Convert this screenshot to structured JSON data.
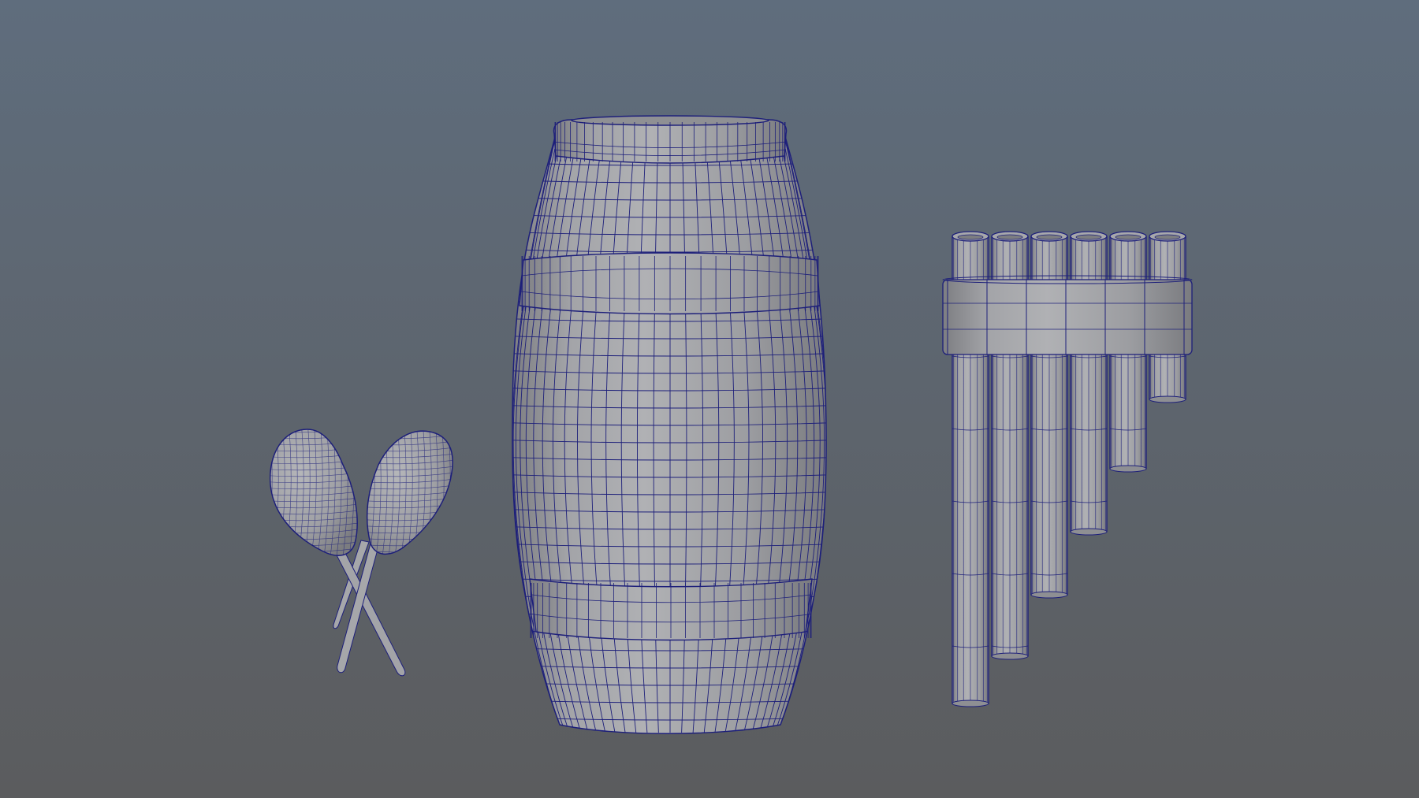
{
  "viewport": {
    "background_top": "#5f6d7d",
    "background_bottom": "#5b5c5e",
    "mesh_surface_light": "#a9aaad",
    "mesh_surface_mid": "#9c9da1",
    "mesh_surface_dark": "#7f8084",
    "wireframe_color": "#1d1f7a"
  },
  "scene": {
    "objects": [
      {
        "name": "maracas",
        "parts": [
          "maraca-left",
          "maraca-right"
        ]
      },
      {
        "name": "barrel-drum",
        "parts": [
          "top-rim",
          "body",
          "upper-band",
          "lower-band"
        ]
      },
      {
        "name": "pan-flute",
        "pipes": 6,
        "parts": [
          "pipes",
          "binding-band"
        ]
      }
    ]
  }
}
